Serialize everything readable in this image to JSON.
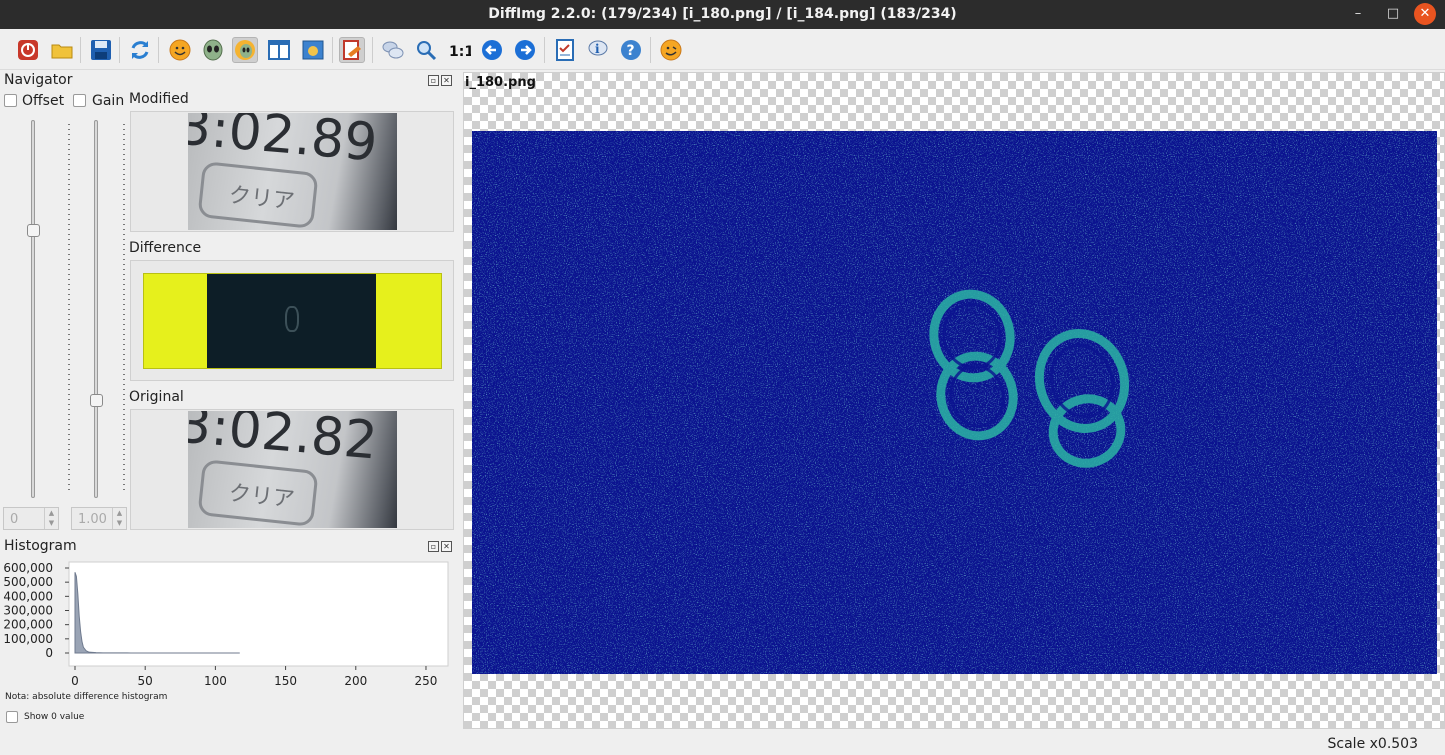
{
  "window": {
    "title": "DiffImg 2.2.0:  (179/234) [i_180.png] / [i_184.png] (183/234)",
    "minimize": "–",
    "maximize": "□",
    "close": "✕"
  },
  "toolbar": [
    "power-icon",
    "open-folder-icon",
    "save-icon",
    "refresh-icon",
    "smiley-icon",
    "alien-icon",
    "alien-diff-icon",
    "split-view-icon",
    "image-view-icon",
    "mask-icon",
    "chat-icon",
    "zoom-fit-icon",
    "zoom-1-1-icon",
    "arrow-left-icon",
    "arrow-right-icon",
    "checklist-icon",
    "info-icon",
    "help-icon",
    "about-icon"
  ],
  "navigator": {
    "title": "Navigator",
    "offset_label": "Offset",
    "gain_label": "Gain",
    "modified_label": "Modified",
    "difference_label": "Difference",
    "original_label": "Original",
    "offset_value": "0",
    "gain_value": "1.00",
    "modified_thumb_text": "3:02.89",
    "modified_button_text": "クリア",
    "original_thumb_text": "3:02.82",
    "original_button_text": "クリア"
  },
  "histogram": {
    "title": "Histogram",
    "note": "Nota: absolute difference histogram",
    "show_zero_label": "Show 0 value"
  },
  "chart_data": {
    "type": "area",
    "title": "",
    "xlabel": "",
    "ylabel": "",
    "xlim": [
      0,
      255
    ],
    "ylim": [
      0,
      600000
    ],
    "yticks": [
      "600,000",
      "500,000",
      "400,000",
      "300,000",
      "200,000",
      "100,000",
      "0"
    ],
    "xticks": [
      "0",
      "50",
      "100",
      "150",
      "200",
      "250"
    ],
    "x": [
      0,
      1,
      2,
      3,
      4,
      5,
      6,
      8,
      10,
      15,
      20,
      40,
      60,
      80,
      100,
      117
    ],
    "values": [
      570000,
      540000,
      420000,
      260000,
      150000,
      80000,
      40000,
      15000,
      6000,
      2500,
      1200,
      400,
      200,
      100,
      50,
      20
    ]
  },
  "viewer": {
    "filename": "i_180.png"
  },
  "status": {
    "scale": "Scale x0.503"
  },
  "colors": {
    "accent_close": "#e95420",
    "diff_background": "#0a0f8a",
    "diff_highlight": "#2bb3a4",
    "difference_thumb_border": "#e8f01c"
  }
}
